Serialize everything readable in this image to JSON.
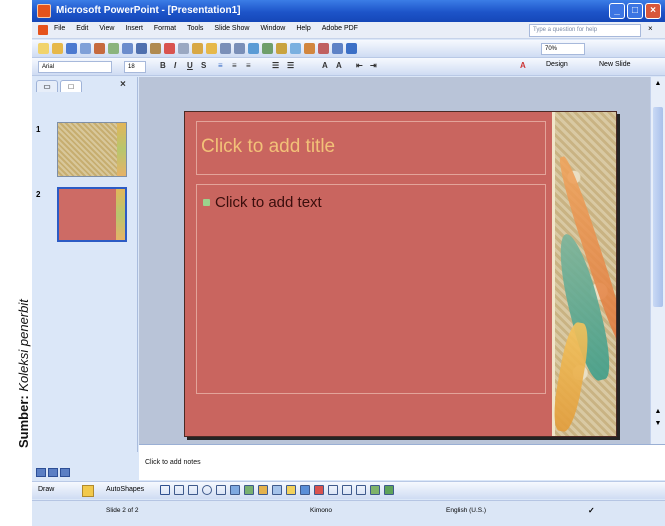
{
  "caption": {
    "label": "Sumber:",
    "text": "Koleksi penerbit"
  },
  "window": {
    "title": "Microsoft PowerPoint - [Presentation1]"
  },
  "menu": {
    "items": [
      "File",
      "Edit",
      "View",
      "Insert",
      "Format",
      "Tools",
      "Slide Show",
      "Window",
      "Help",
      "Adobe PDF"
    ],
    "help_placeholder": "Type a question for help"
  },
  "toolbar": {
    "zoom": "70%",
    "font": "Arial",
    "size": "18",
    "design_label": "Design",
    "new_slide_label": "New Slide"
  },
  "slides_pane": {
    "numbers": [
      "1",
      "2"
    ]
  },
  "slide": {
    "title_placeholder": "Click to add title",
    "body_placeholder": "Click to add text"
  },
  "notes": {
    "placeholder": "Click to add notes"
  },
  "drawing_toolbar": {
    "draw_label": "Draw",
    "autoshapes_label": "AutoShapes"
  },
  "status": {
    "slide": "Slide 2 of 2",
    "design": "Kimono",
    "language": "English (U.S.)"
  }
}
